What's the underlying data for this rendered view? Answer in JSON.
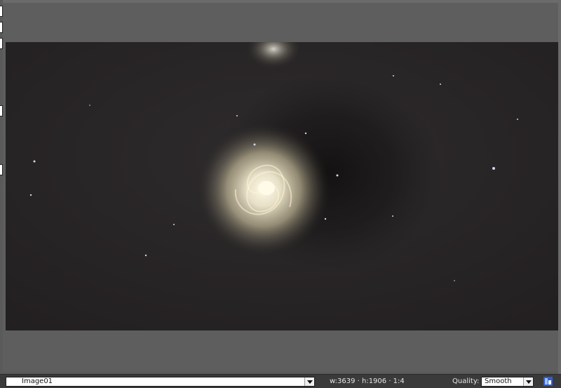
{
  "statusbar": {
    "view_name": "Image01",
    "dimensions": "w:3639 · h:1906 · 1:4",
    "quality_label": "Quality:",
    "quality_value": "Smooth",
    "corner_icon": "pixel-grid-icon"
  },
  "image": {
    "subject_icon": "galaxy-photo"
  },
  "colors": {
    "background": "#5e5e5e",
    "statusbar": "#3a3a3a",
    "image_bg": "#242122"
  }
}
